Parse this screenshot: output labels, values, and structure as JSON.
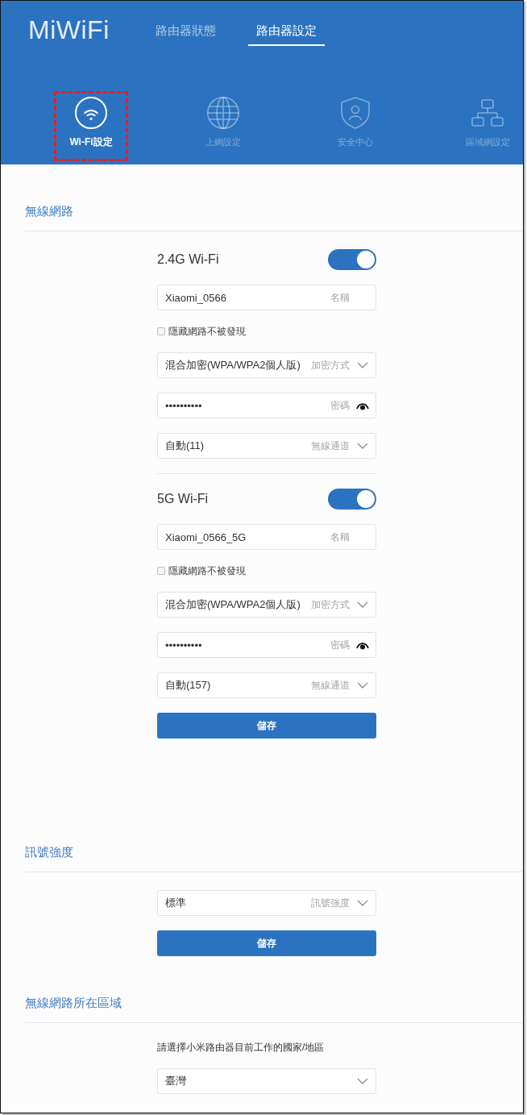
{
  "header": {
    "logo": "MiWiFi",
    "tabs": [
      {
        "label": "路由器狀態",
        "selected": false
      },
      {
        "label": "路由器設定",
        "selected": true
      }
    ],
    "nav": [
      {
        "label": "Wi-Fi設定",
        "selected": true,
        "highlighted": true
      },
      {
        "label": "上網設定",
        "selected": false,
        "highlighted": false
      },
      {
        "label": "安全中心",
        "selected": false,
        "highlighted": false
      },
      {
        "label": "區域網設定",
        "selected": false,
        "highlighted": false
      }
    ]
  },
  "sections": [
    {
      "title": "無線網路",
      "groups": [
        {
          "title": "2.4G Wi-Fi",
          "on": true,
          "fields": [
            {
              "kind": "text",
              "value": "Xiaomi_0566",
              "label": "名稱"
            },
            {
              "kind": "checkbox",
              "label": "隱藏網路不被發現",
              "checked": false
            },
            {
              "kind": "select",
              "value": "混合加密(WPA/WPA2個人版)",
              "label": "加密方式"
            },
            {
              "kind": "password",
              "value": "••••••••••",
              "label": "密碼"
            },
            {
              "kind": "select",
              "value": "自動(11)",
              "label": "無線通道"
            }
          ]
        },
        {
          "title": "5G Wi-Fi",
          "on": true,
          "fields": [
            {
              "kind": "text",
              "value": "Xiaomi_0566_5G",
              "label": "名稱"
            },
            {
              "kind": "checkbox",
              "label": "隱藏網路不被發現",
              "checked": false
            },
            {
              "kind": "select",
              "value": "混合加密(WPA/WPA2個人版)",
              "label": "加密方式"
            },
            {
              "kind": "password",
              "value": "••••••••••",
              "label": "密碼"
            },
            {
              "kind": "select",
              "value": "自動(157)",
              "label": "無線通道"
            }
          ]
        }
      ],
      "button": "儲存"
    },
    {
      "title": "訊號強度",
      "groups": [
        {
          "fields": [
            {
              "kind": "select",
              "value": "標準",
              "label": "訊號強度"
            }
          ]
        }
      ],
      "button": "儲存"
    },
    {
      "title": "無線網路所在區域",
      "groups": [
        {
          "fields": [
            {
              "kind": "note",
              "text": "請選擇小米路由器目前工作的國家/地區"
            },
            {
              "kind": "select",
              "value": "臺灣"
            }
          ]
        }
      ]
    }
  ]
}
